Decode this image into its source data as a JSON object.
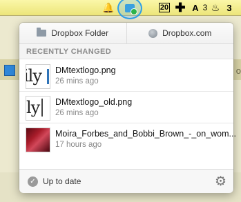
{
  "menubar": {
    "bell_icon": "🔔",
    "calendar_day": "20",
    "plus_icon": "✚",
    "adobe_icon": "A",
    "adobe_sub": "3",
    "flame_icon": "♨",
    "count_icon": "3"
  },
  "background": {
    "edge_letter": "o"
  },
  "toolbar": {
    "dropbox_folder_label": "Dropbox Folder",
    "dropbox_com_label": "Dropbox.com"
  },
  "recent": {
    "header": "RECENTLY CHANGED",
    "items": [
      {
        "name": "DMtextlogo.png",
        "time": "26 mins ago",
        "thumb_text": "ily"
      },
      {
        "name": "DMtextlogo_old.png",
        "time": "26 mins ago",
        "thumb_text": "ly"
      },
      {
        "name": "Moira_Forbes_and_Bobbi_Brown_-_on_wom...",
        "time": "17 hours ago"
      }
    ]
  },
  "footer": {
    "status": "Up to date",
    "check_icon": "✓",
    "gear_icon": "⚙"
  }
}
